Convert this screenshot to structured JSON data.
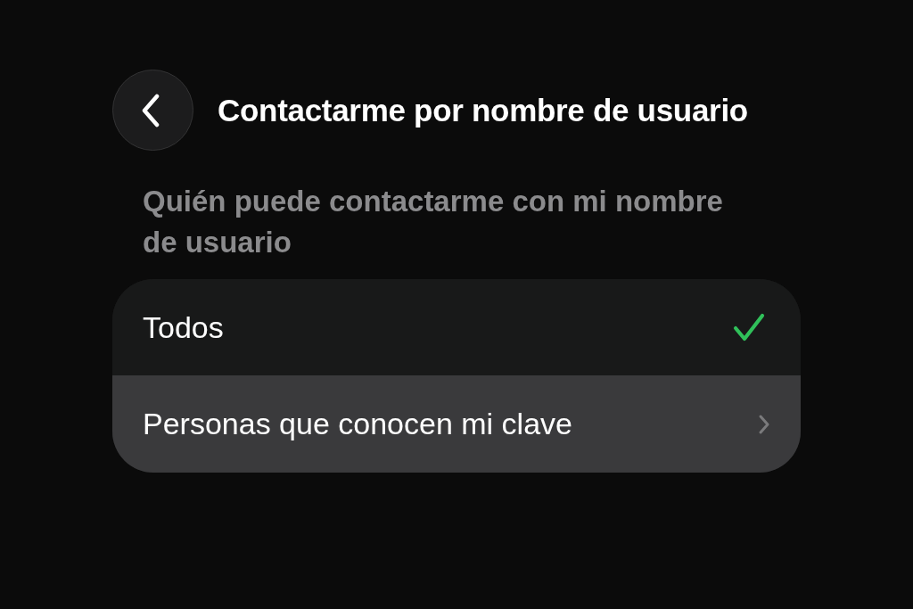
{
  "header": {
    "back_button": true,
    "title": "Contactarme por nombre de usuario"
  },
  "section": {
    "header": "Quién puede contactarme con mi nombre de usuario"
  },
  "options": [
    {
      "label": "Todos",
      "kind": "check",
      "selected": true,
      "highlighted": false
    },
    {
      "label": "Personas que conocen mi clave",
      "kind": "disclosure",
      "selected": false,
      "highlighted": true
    }
  ]
}
